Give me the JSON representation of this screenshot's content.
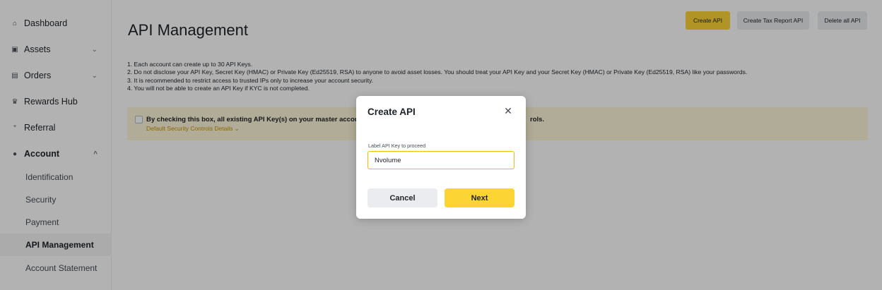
{
  "sidebar": {
    "items": [
      {
        "label": "Dashboard",
        "icon": "home-icon",
        "glyph": "⌂"
      },
      {
        "label": "Assets",
        "icon": "wallet-icon",
        "glyph": "▣",
        "chevron": "⌄"
      },
      {
        "label": "Orders",
        "icon": "orders-icon",
        "glyph": "▤",
        "chevron": "⌄"
      },
      {
        "label": "Rewards Hub",
        "icon": "rewards-icon",
        "glyph": "♛"
      },
      {
        "label": "Referral",
        "icon": "add-user-icon",
        "glyph": "⁺"
      },
      {
        "label": "Account",
        "icon": "user-icon",
        "glyph": "●",
        "chevron": "^"
      }
    ],
    "sub_items": [
      "Identification",
      "Security",
      "Payment",
      "API Management",
      "Account Statement"
    ]
  },
  "header": {
    "title": "API Management",
    "create_api": "Create API",
    "create_tax": "Create Tax Report API",
    "delete_all": "Delete all API"
  },
  "notes": [
    "1. Each account can create up to 30 API Keys.",
    "2. Do not disclose your API Key, Secret Key (HMAC) or Private Key (Ed25519, RSA) to anyone to avoid asset losses. You should treat your API Key and your Secret Key (HMAC) or Private Key (Ed25519, RSA) like your passwords.",
    "3. It is recommended to restrict access to trusted IPs only to increase your account security.",
    "4. You will not be able to create an API Key if KYC is not completed."
  ],
  "banner": {
    "text": "By checking this box, all existing API Key(s) on your master account a",
    "text_tail": "rols.",
    "link": "Default Security Controls Details ⌄"
  },
  "modal": {
    "title": "Create API",
    "close_glyph": "✕",
    "field_label": "Label API Key to proceed",
    "field_value": "Nvolume",
    "cancel": "Cancel",
    "next": "Next"
  },
  "colors": {
    "accent": "#fcd535",
    "input_border": "#f0b90b",
    "link": "#c99400",
    "banner_bg": "#fdf6d8"
  }
}
